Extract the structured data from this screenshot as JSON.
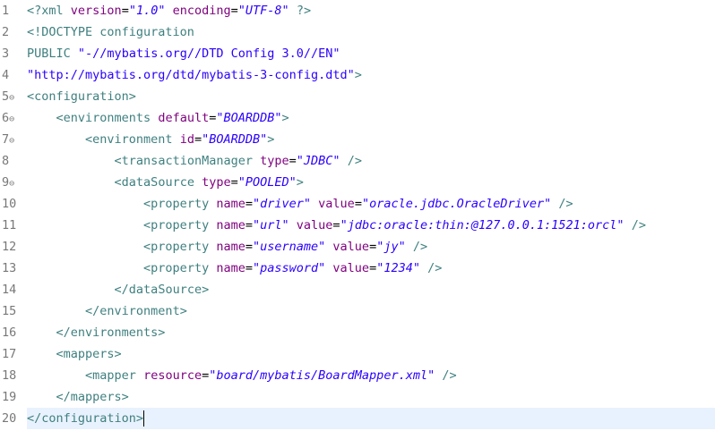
{
  "editor": {
    "line_numbers": [
      "1",
      "2",
      "3",
      "4",
      "5",
      "6",
      "7",
      "8",
      "9",
      "10",
      "11",
      "12",
      "13",
      "14",
      "15",
      "16",
      "17",
      "18",
      "19",
      "20"
    ],
    "folds": {
      "5": "⊖",
      "6": "⊖",
      "7": "⊖",
      "9": "⊖"
    },
    "lines": {
      "l1": {
        "open": "<?xml",
        "a1": "version",
        "v1": "\"1.0\"",
        "a2": "encoding",
        "v2": "\"UTF-8\"",
        "close": "?>"
      },
      "l2": {
        "text": "<!DOCTYPE configuration"
      },
      "l3": {
        "text": "PUBLIC",
        "s": "\"-//mybatis.org//DTD Config 3.0//EN\""
      },
      "l4": {
        "s": "\"http://mybatis.org/dtd/mybatis-3-config.dtd\"",
        "close": ">"
      },
      "l5": {
        "tag": "<configuration>"
      },
      "l6": {
        "open": "<environments",
        "a1": "default",
        "v1": "\"BOARDDB\"",
        "close": ">"
      },
      "l7": {
        "open": "<environment",
        "a1": "id",
        "v1": "\"BOARDDB\"",
        "close": ">"
      },
      "l8": {
        "open": "<transactionManager",
        "a1": "type",
        "v1": "\"JDBC\"",
        "close": "/>"
      },
      "l9": {
        "open": "<dataSource",
        "a1": "type",
        "v1": "\"POOLED\"",
        "close": ">"
      },
      "l10": {
        "open": "<property",
        "a1": "name",
        "v1": "\"driver\"",
        "a2": "value",
        "v2": "\"oracle.jdbc.OracleDriver\"",
        "close": "/>"
      },
      "l11": {
        "open": "<property",
        "a1": "name",
        "v1": "\"url\"",
        "a2": "value",
        "v2": "\"jdbc:oracle:thin:@127.0.0.1:1521:orcl\"",
        "close": "/>"
      },
      "l12": {
        "open": "<property",
        "a1": "name",
        "v1": "\"username\"",
        "a2": "value",
        "v2": "\"jy\"",
        "close": "/>"
      },
      "l13": {
        "open": "<property",
        "a1": "name",
        "v1": "\"password\"",
        "a2": "value",
        "v2": "\"1234\"",
        "close": "/>"
      },
      "l14": {
        "tag": "</dataSource>"
      },
      "l15": {
        "tag": "</environment>"
      },
      "l16": {
        "tag": "</environments>"
      },
      "l17": {
        "tag": "<mappers>"
      },
      "l18": {
        "open": "<mapper",
        "a1": "resource",
        "v1": "\"board/mybatis/BoardMapper.xml\"",
        "close": "/>"
      },
      "l19": {
        "tag": "</mappers>"
      },
      "l20": {
        "tag": "</configuration>"
      }
    },
    "colors": {
      "tag": "#3f7f7f",
      "attr": "#7f007f",
      "value": "#2a00ff",
      "active_line": "#e8f2fe"
    }
  }
}
